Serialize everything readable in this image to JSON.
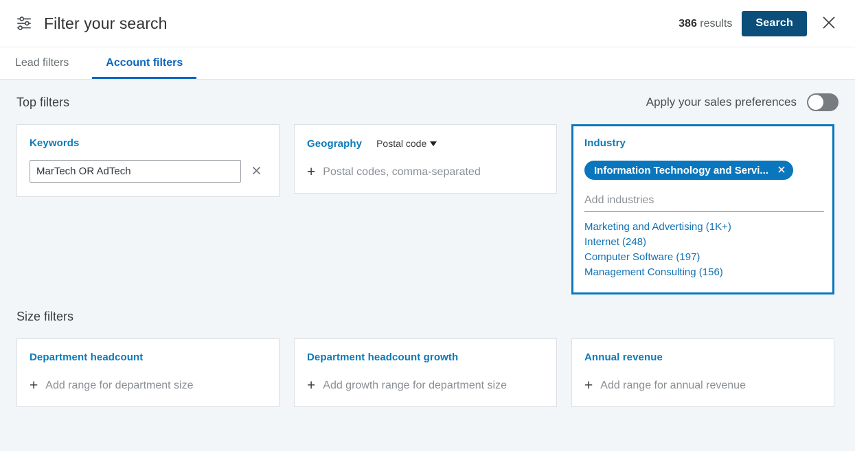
{
  "header": {
    "icon": "sliders-icon",
    "title": "Filter your search",
    "results_count": "386",
    "results_label": "results",
    "search_label": "Search",
    "close_icon": "close-icon"
  },
  "tabs": [
    {
      "label": "Lead filters",
      "active": false
    },
    {
      "label": "Account filters",
      "active": true
    }
  ],
  "top_filters": {
    "section_title": "Top filters",
    "preferences_label": "Apply your sales preferences",
    "preferences_on": false,
    "keywords": {
      "label": "Keywords",
      "value": "MarTech OR AdTech",
      "placeholder": "",
      "clear_icon": "close-icon"
    },
    "geography": {
      "label": "Geography",
      "select_value": "Postal code",
      "add_placeholder": "Postal codes, comma-separated",
      "plus": "+"
    },
    "industry": {
      "label": "Industry",
      "chip": "Information Technology and Servi...",
      "chip_remove_icon": "close-icon",
      "input_placeholder": "Add industries",
      "input_value": "",
      "suggestions": [
        "Marketing and Advertising (1K+)",
        "Internet (248)",
        "Computer Software (197)",
        "Management Consulting (156)"
      ]
    }
  },
  "size_filters": {
    "section_title": "Size filters",
    "cards": [
      {
        "label": "Department headcount",
        "add_text": "Add range for department size",
        "plus": "+"
      },
      {
        "label": "Department headcount growth",
        "add_text": "Add growth range for department size",
        "plus": "+"
      },
      {
        "label": "Annual revenue",
        "add_text": "Add range for annual revenue",
        "plus": "+"
      }
    ]
  },
  "colors": {
    "accent_blue": "#0a66c2",
    "chip_blue": "#0a76bd",
    "search_navy": "#0a4e79",
    "background": "#f3f6f8"
  }
}
